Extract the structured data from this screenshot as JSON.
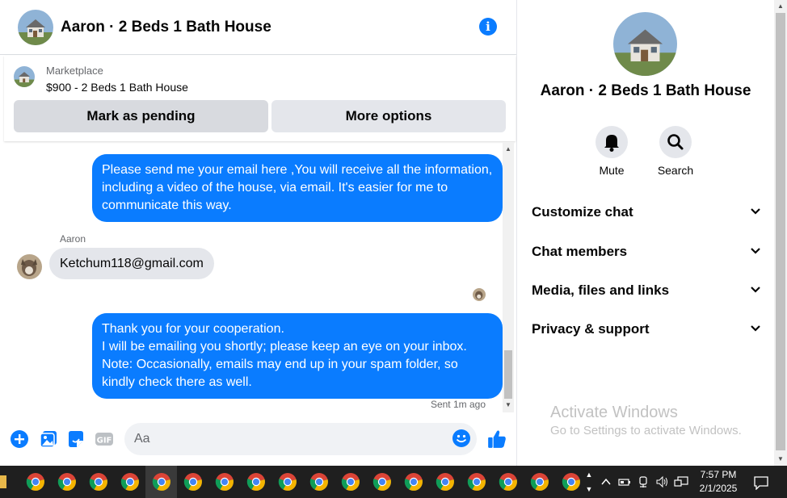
{
  "chat": {
    "title": "Aaron · 2 Beds 1 Bath House",
    "marketplace": {
      "source": "Marketplace",
      "item": "$900 - 2 Beds 1 Bath House",
      "mark_pending": "Mark as pending",
      "more_options": "More options"
    },
    "messages": {
      "outgoing_1": "Please send me your email here ,You will receive all the information, including a video of the house, via email. It's easier for me to communicate this way.",
      "incoming_sender": "Aaron",
      "incoming_1": "Ketchum118@gmail.com",
      "outgoing_2_lines": [
        "Thank you for your cooperation.",
        "I will be emailing you shortly; please keep an eye on your inbox.",
        "Note: Occasionally, emails may end up in your spam folder, so kindly check there as well."
      ],
      "sent_status": "Sent 1m ago"
    },
    "composer": {
      "placeholder": "Aa"
    }
  },
  "panel": {
    "title": "Aaron · 2 Beds 1 Bath House",
    "actions": {
      "mute": "Mute",
      "search": "Search"
    },
    "rows": {
      "customize": "Customize chat",
      "members": "Chat members",
      "media": "Media, files and links",
      "privacy": "Privacy & support"
    },
    "watermark_title": "Activate Windows",
    "watermark_sub": "Go to Settings to activate Windows."
  },
  "taskbar": {
    "time": "7:57 PM",
    "date": "2/1/2025",
    "chrome_count": 18
  },
  "colors": {
    "messenger_blue": "#0a7cff",
    "bubble_gray": "#e4e6eb",
    "taskbar": "#1f1f1f"
  },
  "icons": [
    "info-icon",
    "plus-icon",
    "photo-icon",
    "sticker-icon",
    "gif-icon",
    "emoji-icon",
    "like-icon",
    "bell-icon",
    "search-icon",
    "chevron-down-icon",
    "chrome-icon",
    "caret-up-icon",
    "battery-icon",
    "network-icon",
    "volume-icon",
    "notification-icon"
  ]
}
